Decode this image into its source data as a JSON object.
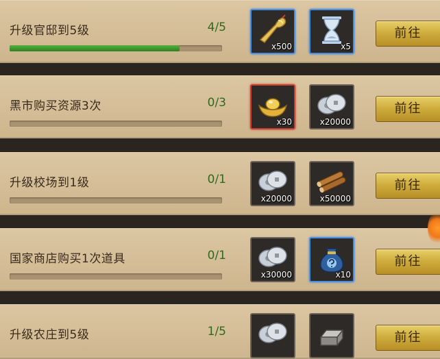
{
  "tasks": [
    {
      "name": "升级官邸到5级",
      "progress": "4/5",
      "progress_fraction": 0.8,
      "rewards": [
        {
          "icon": "gold-ruyi-icon",
          "count": "x500",
          "frame": "blue"
        },
        {
          "icon": "hourglass-icon",
          "count": "x5",
          "frame": "blue"
        }
      ],
      "button": "前往"
    },
    {
      "name": "黑市购买资源3次",
      "progress": "0/3",
      "progress_fraction": 0,
      "rewards": [
        {
          "icon": "gold-ingot-icon",
          "count": "x30",
          "frame": "red"
        },
        {
          "icon": "silver-coins-icon",
          "count": "x20000",
          "frame": "plain"
        }
      ],
      "button": "前往"
    },
    {
      "name": "升级校场到1级",
      "progress": "0/1",
      "progress_fraction": 0,
      "rewards": [
        {
          "icon": "silver-coins-icon",
          "count": "x20000",
          "frame": "plain"
        },
        {
          "icon": "wood-logs-icon",
          "count": "x50000",
          "frame": "plain"
        }
      ],
      "button": "前往"
    },
    {
      "name": "国家商店购买1次道具",
      "progress": "0/1",
      "progress_fraction": 0,
      "rewards": [
        {
          "icon": "silver-coins-icon",
          "count": "x30000",
          "frame": "plain"
        },
        {
          "icon": "mystery-bag-icon",
          "count": "x10",
          "frame": "blue"
        }
      ],
      "button": "前往"
    },
    {
      "name": "升级农庄到5级",
      "progress": "1/5",
      "progress_fraction": 0.2,
      "rewards": [
        {
          "icon": "silver-coins-icon",
          "count": "",
          "frame": "plain"
        },
        {
          "icon": "iron-ingot-icon",
          "count": "",
          "frame": "plain"
        }
      ],
      "button": "前往"
    }
  ],
  "colors": {
    "row_bg": "#d8c29d",
    "progress_text": "#2d6a1e",
    "bar_fill": "#3f9a2c",
    "button_gold": "#cfae3e",
    "frame_blue": "#4a8ee0",
    "frame_red": "#c84030"
  }
}
